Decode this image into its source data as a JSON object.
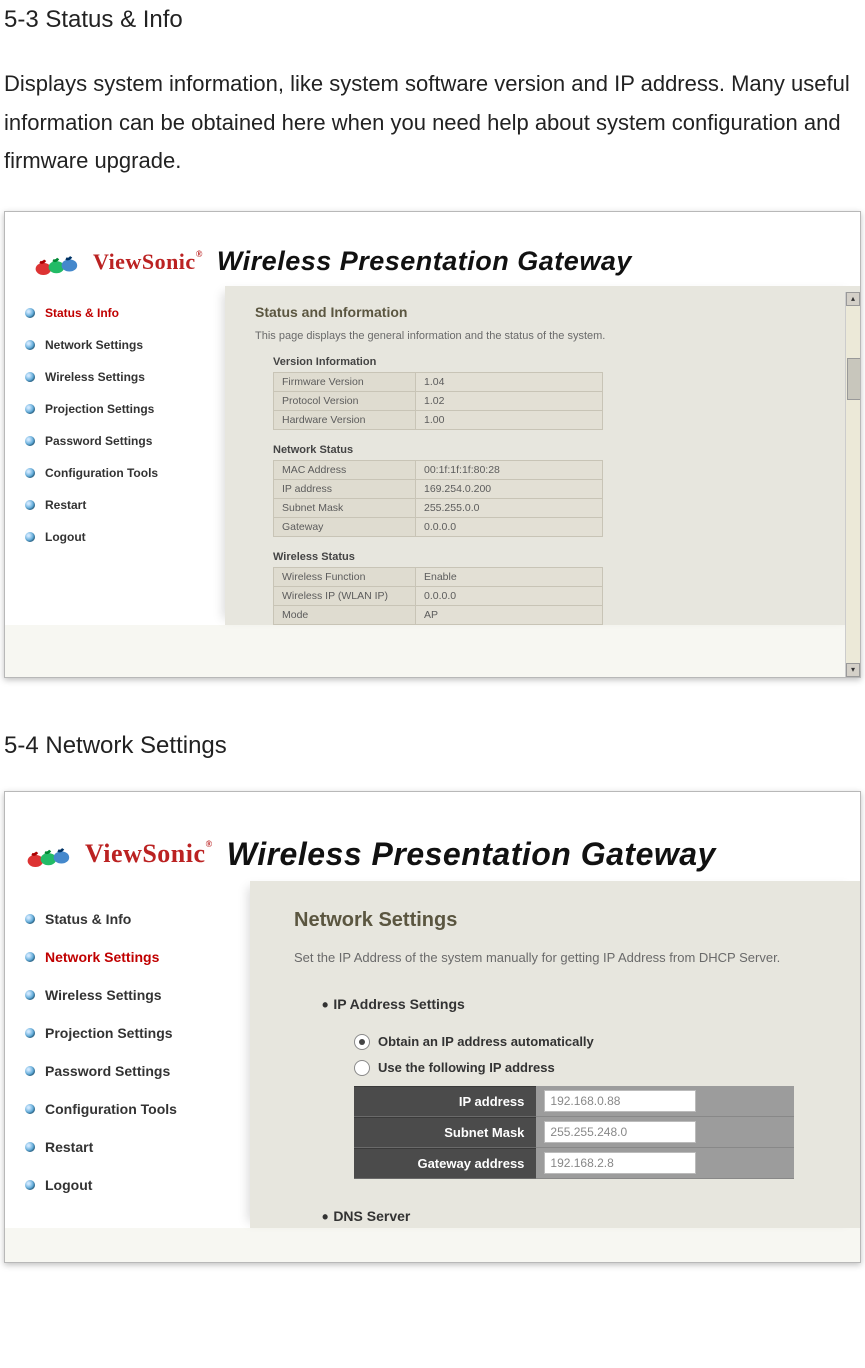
{
  "doc": {
    "heading1": "5-3 Status & Info",
    "para1": "Displays system information, like system software version and IP address. Many useful information can be obtained here when you need help about system configuration and firmware upgrade.",
    "heading2": "5-4 Network Settings"
  },
  "brand": {
    "name": "ViewSonic",
    "reg": "®",
    "title": "Wireless Presentation Gateway"
  },
  "nav": {
    "items": [
      "Status & Info",
      "Network Settings",
      "Wireless Settings",
      "Projection Settings",
      "Password Settings",
      "Configuration Tools",
      "Restart",
      "Logout"
    ]
  },
  "shotA": {
    "title": "Status and Information",
    "desc": "This page displays the general information and the status of the system.",
    "version": {
      "heading": "Version Information",
      "rows": [
        {
          "k": "Firmware Version",
          "v": "1.04"
        },
        {
          "k": "Protocol Version",
          "v": "1.02"
        },
        {
          "k": "Hardware Version",
          "v": "1.00"
        }
      ]
    },
    "network": {
      "heading": "Network Status",
      "rows": [
        {
          "k": "MAC Address",
          "v": "00:1f:1f:1f:80:28"
        },
        {
          "k": "IP address",
          "v": "169.254.0.200"
        },
        {
          "k": "Subnet Mask",
          "v": "255.255.0.0"
        },
        {
          "k": "Gateway",
          "v": "0.0.0.0"
        }
      ]
    },
    "wireless": {
      "heading": "Wireless Status",
      "rows": [
        {
          "k": "Wireless Function",
          "v": "Enable"
        },
        {
          "k": "Wireless IP (WLAN IP)",
          "v": "0.0.0.0"
        },
        {
          "k": "Mode",
          "v": "AP"
        }
      ]
    }
  },
  "shotB": {
    "title": "Network Settings",
    "desc": "Set the IP Address of the system manually for getting IP Address from DHCP Server.",
    "ip_section": "IP Address Settings",
    "radio1": "Obtain an IP address automatically",
    "radio2": "Use the following IP address",
    "fields": {
      "ip": {
        "label": "IP address",
        "value": "192.168.0.88"
      },
      "mask": {
        "label": "Subnet Mask",
        "value": "255.255.248.0"
      },
      "gw": {
        "label": "Gateway address",
        "value": "192.168.2.8"
      }
    },
    "dns_section": "DNS Server"
  }
}
